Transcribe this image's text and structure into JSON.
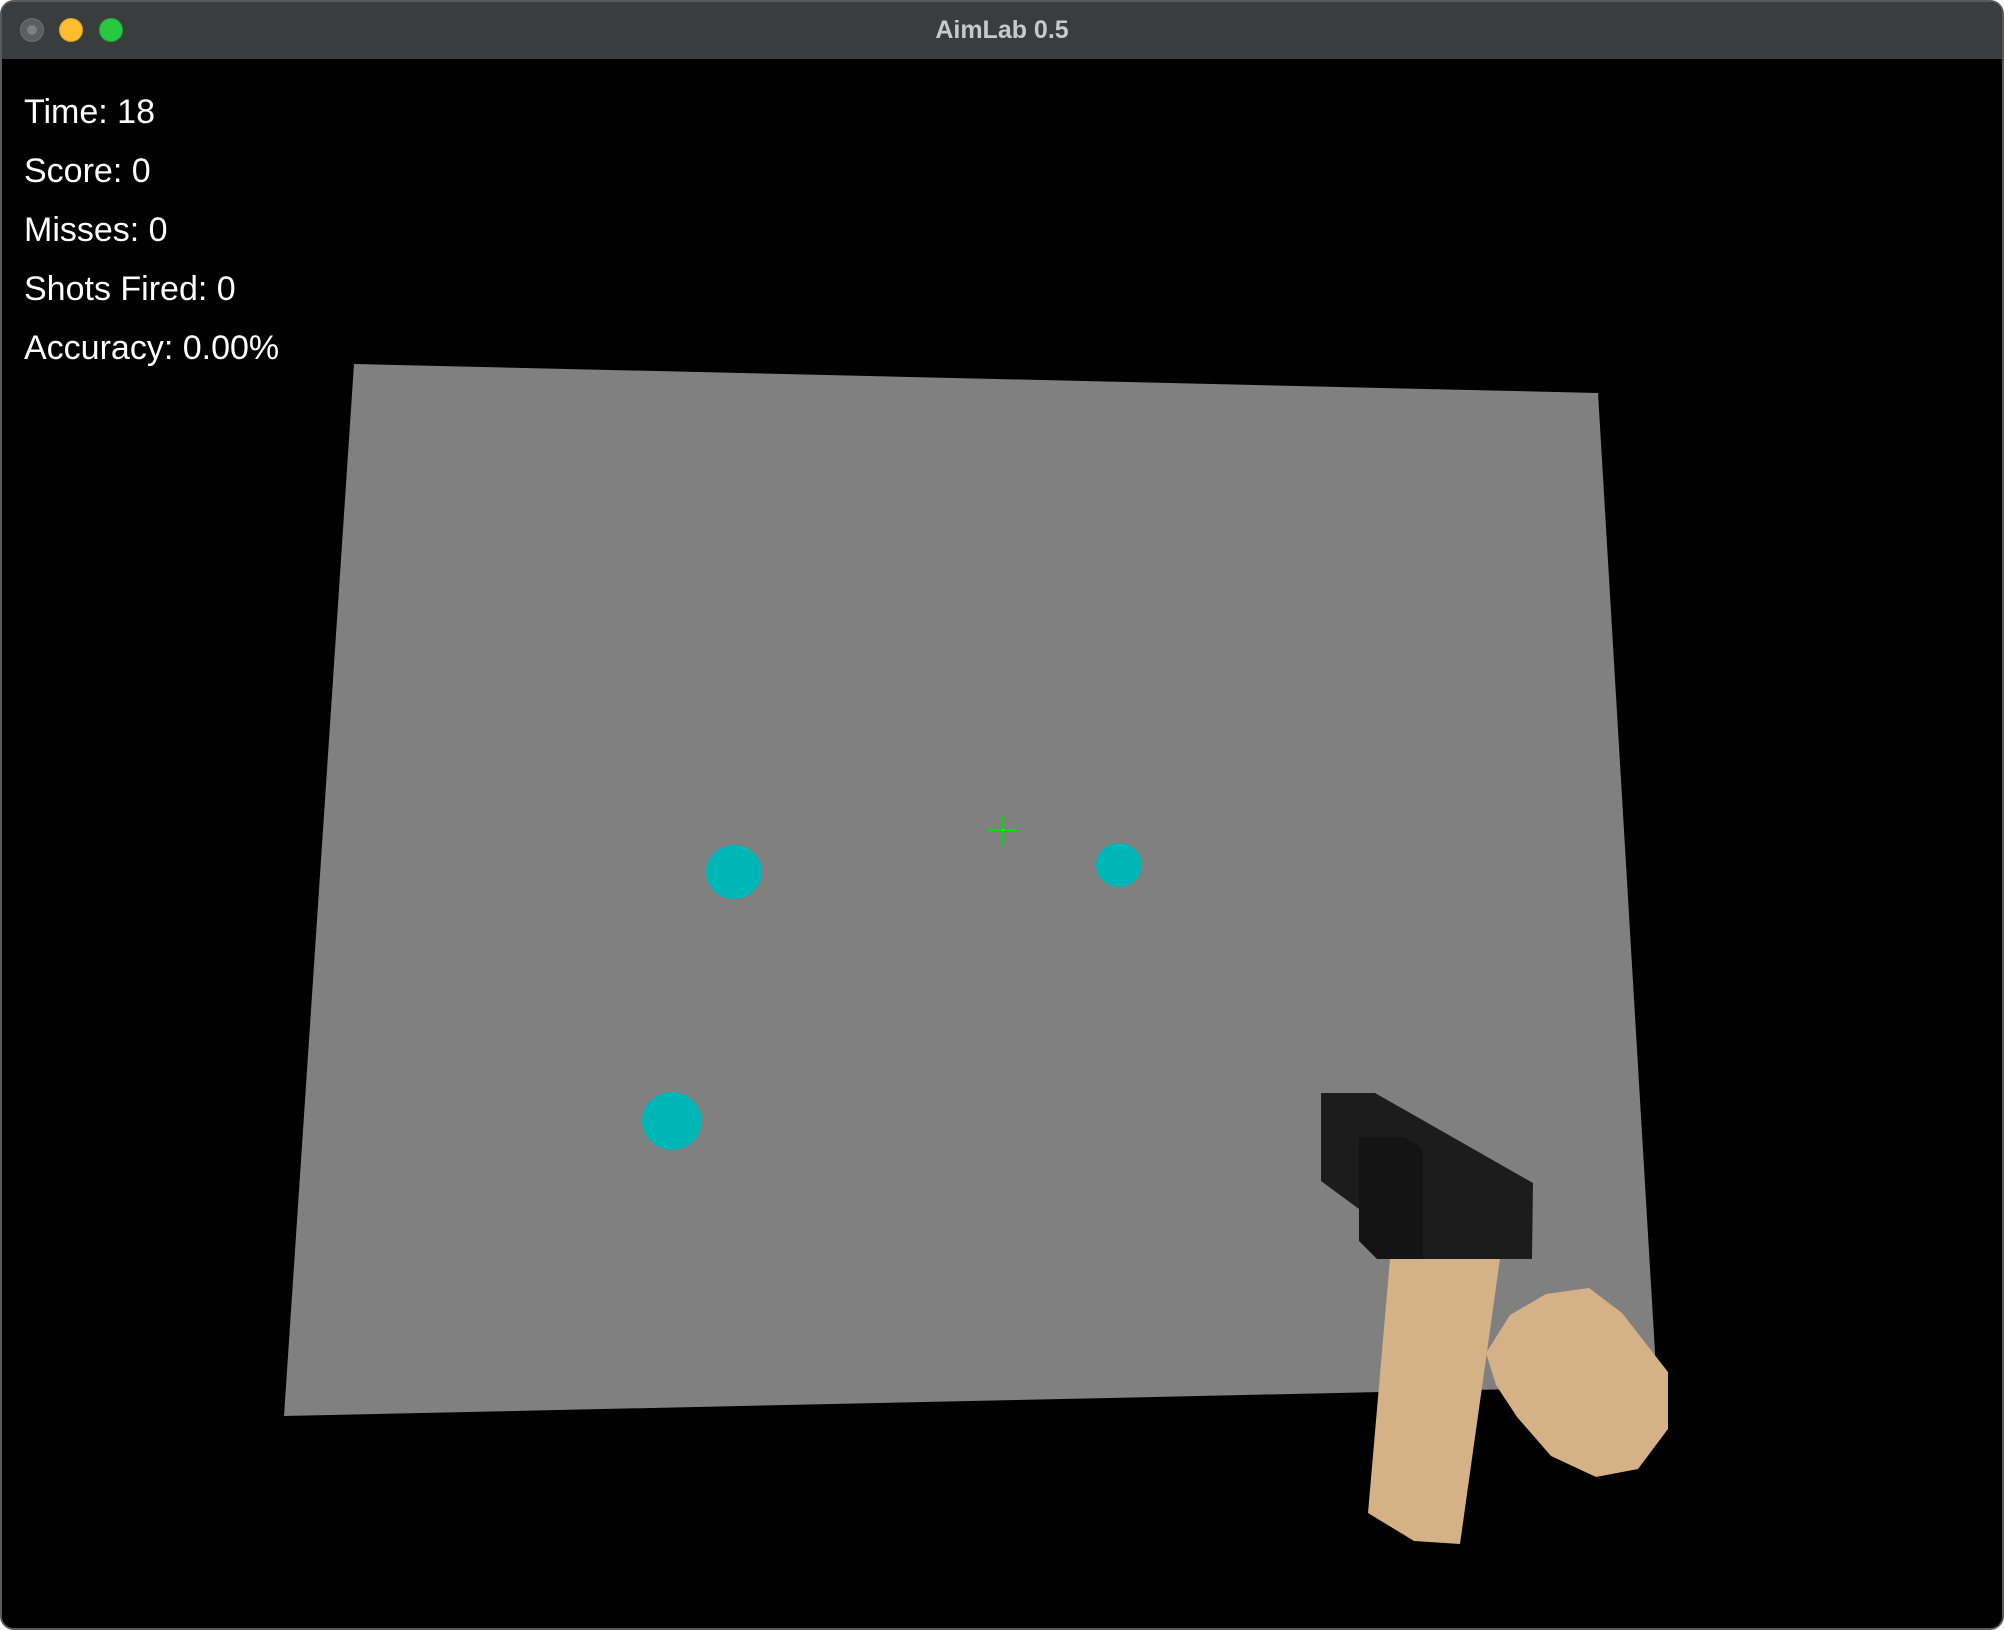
{
  "window": {
    "title": "AimLab 0.5"
  },
  "hud": {
    "time_label": "Time: 18",
    "score_label": "Score: 0",
    "misses_label": "Misses: 0",
    "shots_label": "Shots Fired: 0",
    "accuracy_label": "Accuracy: 0.00%"
  },
  "scene": {
    "background_color": "#000000",
    "wall_color": "#808080",
    "target_color": "#00b5b5",
    "crosshair_color": "#00e000",
    "gun_color": "#1c1c1c",
    "hand_color": "#d4b186",
    "target_count": 3
  }
}
